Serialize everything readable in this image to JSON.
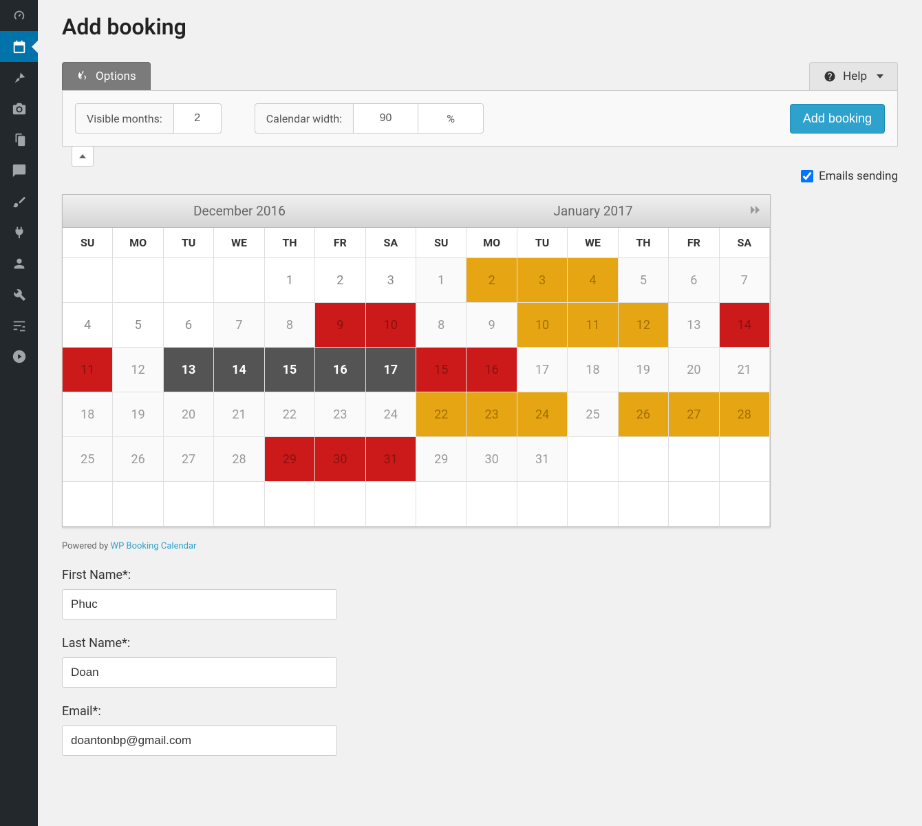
{
  "page": {
    "title": "Add booking"
  },
  "sidebar": {
    "items": [
      {
        "name": "dashboard-icon"
      },
      {
        "name": "booking-icon",
        "active": true
      },
      {
        "name": "pin-icon"
      },
      {
        "name": "media-icon"
      },
      {
        "name": "pages-icon"
      },
      {
        "name": "comments-icon"
      },
      {
        "name": "appearance-icon"
      },
      {
        "name": "plugins-icon"
      },
      {
        "name": "users-icon"
      },
      {
        "name": "tools-icon"
      },
      {
        "name": "settings-icon"
      },
      {
        "name": "slider-icon"
      }
    ]
  },
  "tabs": {
    "options_label": "Options",
    "help_label": "Help"
  },
  "options": {
    "visible_months_label": "Visible months:",
    "visible_months_value": "2",
    "cal_width_label": "Calendar width:",
    "cal_width_value": "90",
    "cal_width_unit": "%"
  },
  "buttons": {
    "add_booking": "Add booking"
  },
  "emails": {
    "label": "Emails sending",
    "checked": true
  },
  "calendar": {
    "months": [
      "December 2016",
      "January 2017"
    ],
    "dows": [
      "SU",
      "MO",
      "TU",
      "WE",
      "TH",
      "FR",
      "SA",
      "SU",
      "MO",
      "TU",
      "WE",
      "TH",
      "FR",
      "SA"
    ],
    "rows": [
      [
        {
          "d": "",
          "s": "blank"
        },
        {
          "d": "",
          "s": "blank"
        },
        {
          "d": "",
          "s": "blank"
        },
        {
          "d": "",
          "s": "blank"
        },
        {
          "d": "1",
          "s": "plain"
        },
        {
          "d": "2",
          "s": "plain"
        },
        {
          "d": "3",
          "s": "plain"
        },
        {
          "d": "1",
          "s": "avail"
        },
        {
          "d": "2",
          "s": "pending"
        },
        {
          "d": "3",
          "s": "pending"
        },
        {
          "d": "4",
          "s": "pending"
        },
        {
          "d": "5",
          "s": "avail"
        },
        {
          "d": "6",
          "s": "avail"
        },
        {
          "d": "7",
          "s": "avail"
        }
      ],
      [
        {
          "d": "4",
          "s": "plain"
        },
        {
          "d": "5",
          "s": "plain"
        },
        {
          "d": "6",
          "s": "plain"
        },
        {
          "d": "7",
          "s": "avail"
        },
        {
          "d": "8",
          "s": "avail"
        },
        {
          "d": "9",
          "s": "booked-red"
        },
        {
          "d": "10",
          "s": "booked-red"
        },
        {
          "d": "8",
          "s": "avail"
        },
        {
          "d": "9",
          "s": "avail"
        },
        {
          "d": "10",
          "s": "pending"
        },
        {
          "d": "11",
          "s": "pending"
        },
        {
          "d": "12",
          "s": "pending"
        },
        {
          "d": "13",
          "s": "avail"
        },
        {
          "d": "14",
          "s": "booked-red"
        }
      ],
      [
        {
          "d": "11",
          "s": "booked-red"
        },
        {
          "d": "12",
          "s": "avail"
        },
        {
          "d": "13",
          "s": "selected"
        },
        {
          "d": "14",
          "s": "selected"
        },
        {
          "d": "15",
          "s": "selected"
        },
        {
          "d": "16",
          "s": "selected"
        },
        {
          "d": "17",
          "s": "selected"
        },
        {
          "d": "15",
          "s": "booked-red"
        },
        {
          "d": "16",
          "s": "booked-red"
        },
        {
          "d": "17",
          "s": "avail"
        },
        {
          "d": "18",
          "s": "avail"
        },
        {
          "d": "19",
          "s": "avail"
        },
        {
          "d": "20",
          "s": "avail"
        },
        {
          "d": "21",
          "s": "avail"
        }
      ],
      [
        {
          "d": "18",
          "s": "avail"
        },
        {
          "d": "19",
          "s": "avail"
        },
        {
          "d": "20",
          "s": "avail"
        },
        {
          "d": "21",
          "s": "avail"
        },
        {
          "d": "22",
          "s": "avail"
        },
        {
          "d": "23",
          "s": "avail"
        },
        {
          "d": "24",
          "s": "avail"
        },
        {
          "d": "22",
          "s": "pending"
        },
        {
          "d": "23",
          "s": "pending"
        },
        {
          "d": "24",
          "s": "pending"
        },
        {
          "d": "25",
          "s": "avail"
        },
        {
          "d": "26",
          "s": "pending"
        },
        {
          "d": "27",
          "s": "pending"
        },
        {
          "d": "28",
          "s": "pending"
        }
      ],
      [
        {
          "d": "25",
          "s": "avail"
        },
        {
          "d": "26",
          "s": "avail"
        },
        {
          "d": "27",
          "s": "avail"
        },
        {
          "d": "28",
          "s": "avail"
        },
        {
          "d": "29",
          "s": "booked-red"
        },
        {
          "d": "30",
          "s": "booked-red"
        },
        {
          "d": "31",
          "s": "booked-red"
        },
        {
          "d": "29",
          "s": "avail"
        },
        {
          "d": "30",
          "s": "avail"
        },
        {
          "d": "31",
          "s": "avail"
        },
        {
          "d": "",
          "s": "plain"
        },
        {
          "d": "",
          "s": "plain"
        },
        {
          "d": "",
          "s": "plain"
        },
        {
          "d": "",
          "s": "plain"
        }
      ],
      [
        {
          "d": "",
          "s": "blank"
        },
        {
          "d": "",
          "s": "blank"
        },
        {
          "d": "",
          "s": "blank"
        },
        {
          "d": "",
          "s": "blank"
        },
        {
          "d": "",
          "s": "blank"
        },
        {
          "d": "",
          "s": "blank"
        },
        {
          "d": "",
          "s": "blank"
        },
        {
          "d": "",
          "s": "blank"
        },
        {
          "d": "",
          "s": "blank"
        },
        {
          "d": "",
          "s": "blank"
        },
        {
          "d": "",
          "s": "blank"
        },
        {
          "d": "",
          "s": "blank"
        },
        {
          "d": "",
          "s": "blank"
        },
        {
          "d": "",
          "s": "blank"
        }
      ]
    ]
  },
  "powered": {
    "text": "Powered by ",
    "link": "WP Booking Calendar"
  },
  "form": {
    "first_name_label": "First Name*:",
    "first_name_value": "Phuc",
    "last_name_label": "Last Name*:",
    "last_name_value": "Doan",
    "email_label": "Email*:",
    "email_value": "doantonbp@gmail.com"
  }
}
